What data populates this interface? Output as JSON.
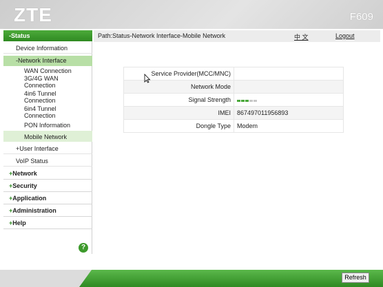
{
  "header": {
    "logo": "ZTE",
    "model": "F609"
  },
  "sidebar": {
    "status": "-Status",
    "device_information": "Device Information",
    "network_interface": "-Network Interface",
    "wan_connection": "WAN Connection",
    "wan_3g4g_line1": "3G/4G WAN",
    "wan_3g4g_line2": "Connection",
    "tunnel_4in6_line1": "4in6 Tunnel",
    "tunnel_4in6_line2": "Connection",
    "tunnel_6in4_line1": "6in4 Tunnel",
    "tunnel_6in4_line2": "Connection",
    "pon_information": "PON Information",
    "mobile_network": "Mobile Network",
    "user_interface": "+User Interface",
    "voip_status": "VoIP Status",
    "network": "Network",
    "security": "Security",
    "application": "Application",
    "administration": "Administration",
    "help": "Help",
    "plus_sign": "+",
    "help_icon": "?"
  },
  "main": {
    "path": "Path:Status-Network Interface-Mobile Network",
    "language": "中 文",
    "logout": "Logout",
    "rows": [
      {
        "label": "Service Provider(MCC/MNC)",
        "value": ""
      },
      {
        "label": "Network Mode",
        "value": ""
      },
      {
        "label": "Signal Strength",
        "value": ""
      },
      {
        "label": "IMEI",
        "value": "867497011956893"
      },
      {
        "label": "Dongle Type",
        "value": "Modem"
      }
    ],
    "signal_strength": {
      "bars_on": 3,
      "bars_total": 5,
      "color_on": "#4aa83a",
      "color_off": "#c8c8c8"
    }
  },
  "footer": {
    "refresh": "Refresh",
    "accent_color": "#2f8a22"
  }
}
